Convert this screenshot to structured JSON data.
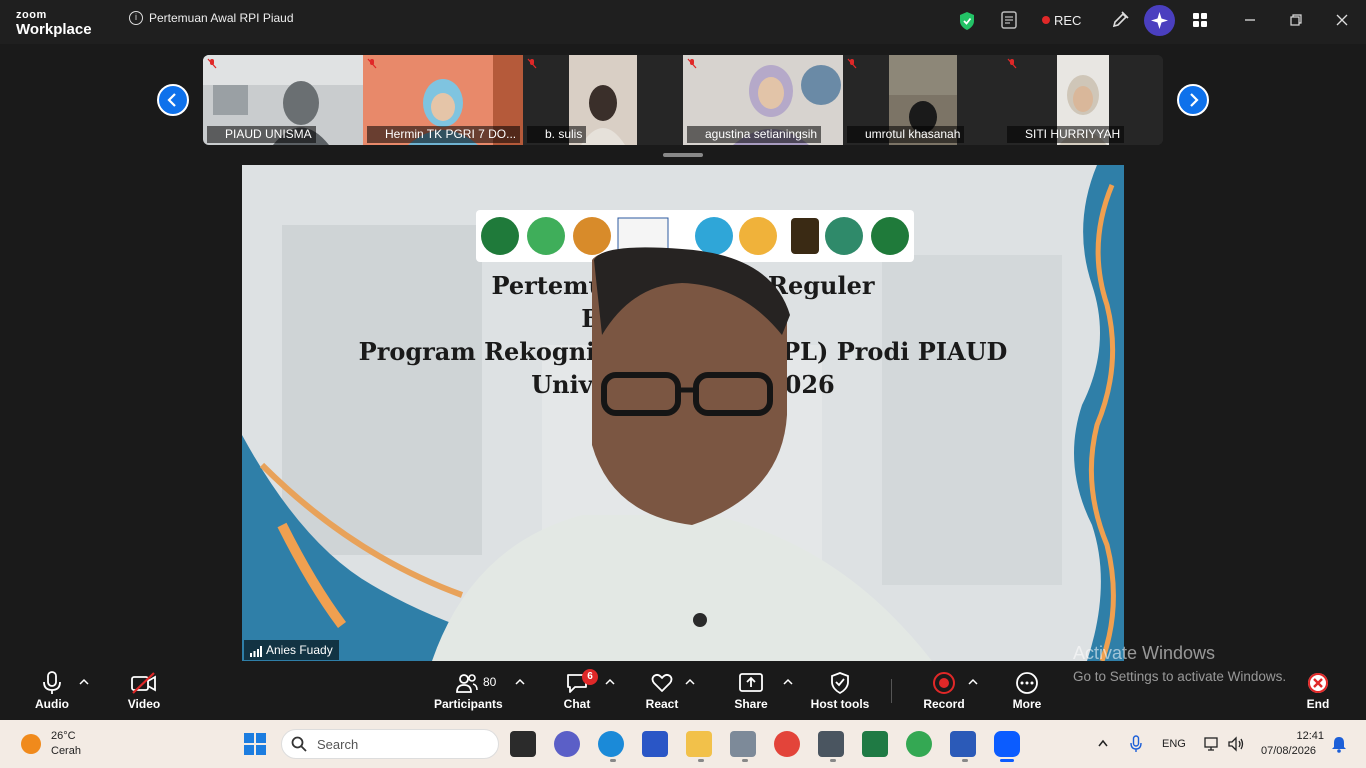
{
  "app": {
    "brand_top": "zoom",
    "brand_bottom": "Workplace",
    "meeting_title": "Pertemuan Awal RPI Piaud"
  },
  "titlebar": {
    "rec_label": "REC"
  },
  "gallery": {
    "participants": [
      {
        "name": "PIAUD UNISMA",
        "muted": true
      },
      {
        "name": "Hermin TK PGRI 7 DO...",
        "muted": true
      },
      {
        "name": "b. sulis",
        "muted": true
      },
      {
        "name": "agustina setianingsih",
        "muted": true
      },
      {
        "name": "umrotul khasanah",
        "muted": true
      },
      {
        "name": "SITI HURRIYYAH",
        "muted": true
      }
    ]
  },
  "main_video": {
    "speaker_name": "Anies Fuady",
    "slide_lines": [
      "Pertemuan Av          siswa Reguler",
      "Beasisw                 asmen",
      "Program Rekognisi Pem              pau (RPL) Prodi PIAUD",
      "Universitas              ahun 2026"
    ]
  },
  "watermark": {
    "title": "Activate Windows",
    "subtitle": "Go to Settings to activate Windows."
  },
  "toolbar": {
    "audio": "Audio",
    "video": "Video",
    "participants": "Participants",
    "participants_count": "80",
    "chat": "Chat",
    "chat_badge": "6",
    "react": "React",
    "share": "Share",
    "host_tools": "Host tools",
    "record": "Record",
    "more": "More",
    "end": "End"
  },
  "taskbar": {
    "weather_temp": "26°C",
    "weather_cond": "Cerah",
    "search_label": "Search",
    "language": "ENG",
    "time": "12:41",
    "date": "07/08/2026"
  },
  "colors": {
    "accent": "#0e71eb",
    "record": "#e02828",
    "end": "#e02828"
  }
}
